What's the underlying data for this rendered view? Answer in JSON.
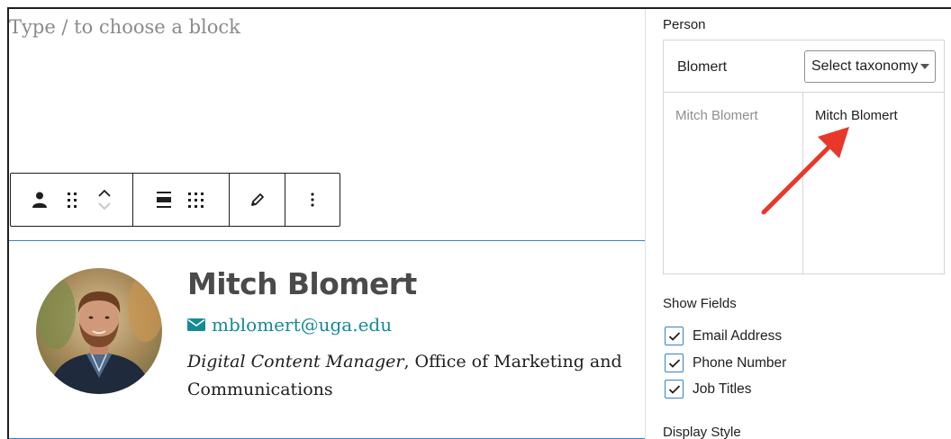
{
  "editor": {
    "placeholder": "Type / to choose a block",
    "toolbar": {
      "block_icon": "person-icon",
      "drag_icon": "drag-handle-icon",
      "move_up_icon": "chevron-up-icon",
      "move_down_icon": "chevron-down-icon",
      "align_icon": "align-icon",
      "layout_icon": "grid-dots-icon",
      "edit_icon": "pencil-icon",
      "more_icon": "more-vertical-icon"
    },
    "profile": {
      "name": "Mitch Blomert",
      "email": "mblomert@uga.edu",
      "job_title": "Digital Content Manager",
      "job_rest": ", Office of Marketing and Communications",
      "photo_icon": "profile-photo"
    }
  },
  "sidebar": {
    "person_label": "Person",
    "taxonomy": {
      "term": "Blomert",
      "select_value": "Select taxonomy",
      "available": "Mitch Blomert",
      "chosen": "Mitch Blomert"
    },
    "show_fields_label": "Show Fields",
    "fields": [
      {
        "label": "Email Address",
        "checked": true
      },
      {
        "label": "Phone Number",
        "checked": true
      },
      {
        "label": "Job Titles",
        "checked": true
      }
    ],
    "display_style_label": "Display Style"
  },
  "colors": {
    "link": "#148a96",
    "block_border": "#3582c4",
    "annotation_arrow": "#e8382a",
    "heading": "#4a4a4a"
  }
}
